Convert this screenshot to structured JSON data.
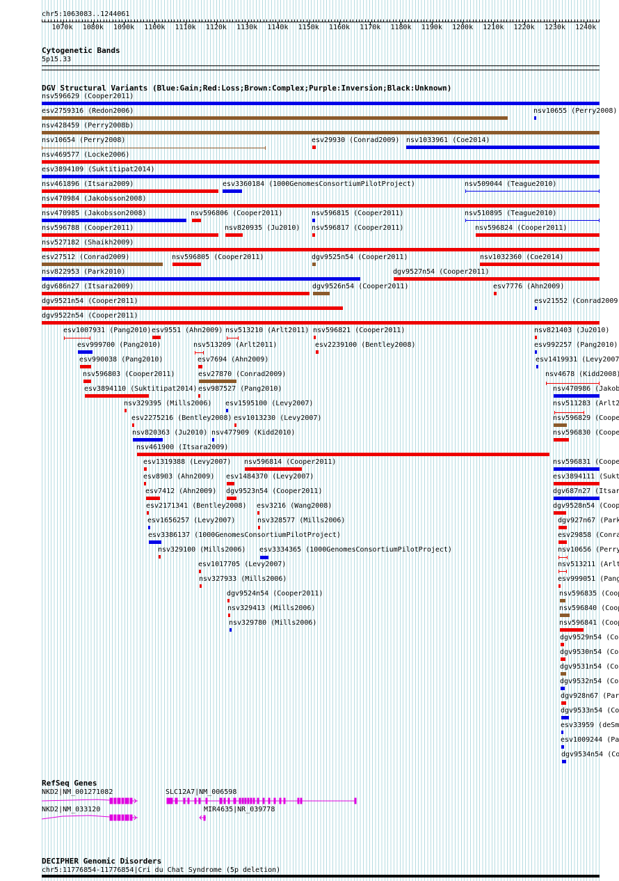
{
  "range_label": "chr5:1063083..1244061",
  "ruler": {
    "ticks": [
      "1070k",
      "1080k",
      "1090k",
      "1100k",
      "1110k",
      "1120k",
      "1130k",
      "1140k",
      "1150k",
      "1160k",
      "1170k",
      "1180k",
      "1190k",
      "1200k",
      "1210k",
      "1220k",
      "1230k",
      "1240k"
    ]
  },
  "cyto": {
    "title": "Cytogenetic Bands",
    "band": "5p15.33"
  },
  "dgv": {
    "title": "DGV Structural Variants (Blue:Gain;Red:Loss;Brown:Complex;Purple:Inversion;Black:Unknown)"
  },
  "colors": {
    "gain": "#0000e8",
    "loss": "#ee0000",
    "complex": "#8b5a2b",
    "grid": "#78bec8",
    "gene": "#e000e0"
  },
  "variants": [
    {
      "name": "nsv596629 (Cooper2011)",
      "type": "gain"
    },
    {
      "name": "esv2759316 (Redon2006)",
      "type": "complex"
    },
    {
      "name": "nsv10655 (Perry2008)",
      "type": "gain"
    },
    {
      "name": "nsv428459 (Perry2008b)",
      "type": "complex"
    },
    {
      "name": "nsv10654 (Perry2008)",
      "type": "complex"
    },
    {
      "name": "esv29930 (Conrad2009)",
      "type": "loss"
    },
    {
      "name": "nsv1033961 (Coe2014)",
      "type": "gain"
    },
    {
      "name": "nsv469577 (Locke2006)",
      "type": "loss"
    },
    {
      "name": "esv3894109 (Suktitipat2014)",
      "type": "gain"
    },
    {
      "name": "nsv461896 (Itsara2009)",
      "type": "loss"
    },
    {
      "name": "esv3360184 (1000GenomesConsortiumPilotProject)",
      "type": "gain"
    },
    {
      "name": "nsv509044 (Teague2010)",
      "type": "gain"
    },
    {
      "name": "nsv470984 (Jakobsson2008)",
      "type": "loss"
    },
    {
      "name": "nsv470985 (Jakobsson2008)",
      "type": "gain"
    },
    {
      "name": "nsv596806 (Cooper2011)",
      "type": "loss"
    },
    {
      "name": "nsv596815 (Cooper2011)",
      "type": "gain"
    },
    {
      "name": "nsv510895 (Teague2010)",
      "type": "gain"
    },
    {
      "name": "nsv596788 (Cooper2011)",
      "type": "loss"
    },
    {
      "name": "nsv820935 (Ju2010)",
      "type": "loss"
    },
    {
      "name": "nsv596817 (Cooper2011)",
      "type": "loss"
    },
    {
      "name": "nsv596824 (Cooper2011)",
      "type": "loss"
    },
    {
      "name": "nsv527182 (Shaikh2009)",
      "type": "loss"
    },
    {
      "name": "esv27512 (Conrad2009)",
      "type": "complex"
    },
    {
      "name": "nsv596805 (Cooper2011)",
      "type": "loss"
    },
    {
      "name": "dgv9525n54 (Cooper2011)",
      "type": "complex"
    },
    {
      "name": "nsv1032360 (Coe2014)",
      "type": "loss"
    },
    {
      "name": "nsv822953 (Park2010)",
      "type": "gain"
    },
    {
      "name": "dgv9527n54 (Cooper2011)",
      "type": "loss"
    },
    {
      "name": "dgv686n27 (Itsara2009)",
      "type": "loss"
    },
    {
      "name": "dgv9526n54 (Cooper2011)",
      "type": "complex"
    },
    {
      "name": "esv7776 (Ahn2009)",
      "type": "loss"
    },
    {
      "name": "dgv9521n54 (Cooper2011)",
      "type": "loss"
    },
    {
      "name": "esv21552 (Conrad2009",
      "type": "gain"
    },
    {
      "name": "dgv9522n54 (Cooper2011)",
      "type": "loss"
    },
    {
      "name": "esv1007931 (Pang2010)",
      "type": "loss"
    },
    {
      "name": "esv9551 (Ahn2009)",
      "type": "loss"
    },
    {
      "name": "nsv513210 (Arlt2011)",
      "type": "loss"
    },
    {
      "name": "nsv596821 (Cooper2011)",
      "type": "loss"
    },
    {
      "name": "nsv821403 (Ju2010)",
      "type": "loss"
    },
    {
      "name": "esv999700 (Pang2010)",
      "type": "gain"
    },
    {
      "name": "nsv513209 (Arlt2011)",
      "type": "loss"
    },
    {
      "name": "esv2239100 (Bentley2008)",
      "type": "loss"
    },
    {
      "name": "esv992257 (Pang2010)",
      "type": "gain"
    },
    {
      "name": "esv990038 (Pang2010)",
      "type": "loss"
    },
    {
      "name": "esv7694 (Ahn2009)",
      "type": "loss"
    },
    {
      "name": "esv1419931 (Levy2007",
      "type": "gain"
    },
    {
      "name": "nsv596803 (Cooper2011)",
      "type": "loss"
    },
    {
      "name": "esv27870 (Conrad2009)",
      "type": "complex"
    },
    {
      "name": "nsv4678 (Kidd2008)",
      "type": "loss"
    },
    {
      "name": "esv3894110 (Suktitipat2014)",
      "type": "loss"
    },
    {
      "name": "esv987527 (Pang2010)",
      "type": "loss"
    },
    {
      "name": "nsv470986 (Jakob",
      "type": "gain"
    },
    {
      "name": "nsv329395 (Mills2006)",
      "type": "loss"
    },
    {
      "name": "esv1595100 (Levy2007)",
      "type": "gain"
    },
    {
      "name": "nsv511283 (Arlt2",
      "type": "loss"
    },
    {
      "name": "esv2275216 (Bentley2008)",
      "type": "loss"
    },
    {
      "name": "esv1013230 (Levy2007)",
      "type": "loss"
    },
    {
      "name": "nsv596829 (Coope",
      "type": "complex"
    },
    {
      "name": "nsv820363 (Ju2010)",
      "type": "gain"
    },
    {
      "name": "nsv477909 (Kidd2010)",
      "type": "gain"
    },
    {
      "name": "nsv596830 (Coope",
      "type": "loss"
    },
    {
      "name": "nsv461900 (Itsara2009)",
      "type": "loss"
    },
    {
      "name": "esv1319388 (Levy2007)",
      "type": "loss"
    },
    {
      "name": "nsv596814 (Cooper2011)",
      "type": "loss"
    },
    {
      "name": "nsv596831 (Coope",
      "type": "gain"
    },
    {
      "name": "esv8903 (Ahn2009)",
      "type": "loss"
    },
    {
      "name": "esv1484370 (Levy2007)",
      "type": "loss"
    },
    {
      "name": "esv3894111 (Sukt",
      "type": "loss"
    },
    {
      "name": "esv7412 (Ahn2009)",
      "type": "loss"
    },
    {
      "name": "dgv9523n54 (Cooper2011)",
      "type": "loss"
    },
    {
      "name": "dgv687n27 (Itsar",
      "type": "gain"
    },
    {
      "name": "esv2171341 (Bentley2008)",
      "type": "loss"
    },
    {
      "name": "esv3216 (Wang2008)",
      "type": "loss"
    },
    {
      "name": "dgv9528n54 (Coop",
      "type": "loss"
    },
    {
      "name": "esv1656257 (Levy2007)",
      "type": "gain"
    },
    {
      "name": "nsv328577 (Mills2006)",
      "type": "loss"
    },
    {
      "name": "dgv927n67 (Park",
      "type": "loss"
    },
    {
      "name": "esv3386137 (1000GenomesConsortiumPilotProject)",
      "type": "gain"
    },
    {
      "name": "esv29858 (Conra",
      "type": "loss"
    },
    {
      "name": "nsv329100 (Mills2006)",
      "type": "loss"
    },
    {
      "name": "esv3334365 (1000GenomesConsortiumPilotProject)",
      "type": "gain"
    },
    {
      "name": "nsv10656 (Perry",
      "type": "loss"
    },
    {
      "name": "esv1017705 (Levy2007)",
      "type": "loss"
    },
    {
      "name": "nsv513211 (Arlt",
      "type": "loss"
    },
    {
      "name": "nsv327933 (Mills2006)",
      "type": "loss"
    },
    {
      "name": "esv999051 (Pang",
      "type": "loss"
    },
    {
      "name": "dgv9524n54 (Cooper2011)",
      "type": "loss"
    },
    {
      "name": "nsv596835 (Coop",
      "type": "complex"
    },
    {
      "name": "nsv329413 (Mills2006)",
      "type": "loss"
    },
    {
      "name": "nsv596840 (Coop",
      "type": "complex"
    },
    {
      "name": "nsv329780 (Mills2006)",
      "type": "gain"
    },
    {
      "name": "nsv596841 (Coop",
      "type": "loss"
    },
    {
      "name": "dgv9529n54 (Coo",
      "type": "loss"
    },
    {
      "name": "dgv9530n54 (Coo",
      "type": "loss"
    },
    {
      "name": "dgv9531n54 (Coo",
      "type": "complex"
    },
    {
      "name": "dgv9532n54 (Coo",
      "type": "gain"
    },
    {
      "name": "dgv928n67 (Par",
      "type": "loss"
    },
    {
      "name": "dgv9533n54 (Co",
      "type": "gain"
    },
    {
      "name": "esv33959 (deSm",
      "type": "gain"
    },
    {
      "name": "esv1009244 (Pa",
      "type": "gain"
    },
    {
      "name": "dgv9534n54 (Co",
      "type": "gain"
    }
  ],
  "refseq": {
    "title": "RefSeq Genes",
    "genes": [
      "NKD2|NM_001271082",
      "SLC12A7|NM_006598",
      "NKD2|NM_033120",
      "MIR4635|NR_039778"
    ]
  },
  "decipher": {
    "title": "DECIPHER Genomic Disorders",
    "entry": "chr5:11776854-11776854|Cri du Chat Syndrome (5p deletion)"
  }
}
